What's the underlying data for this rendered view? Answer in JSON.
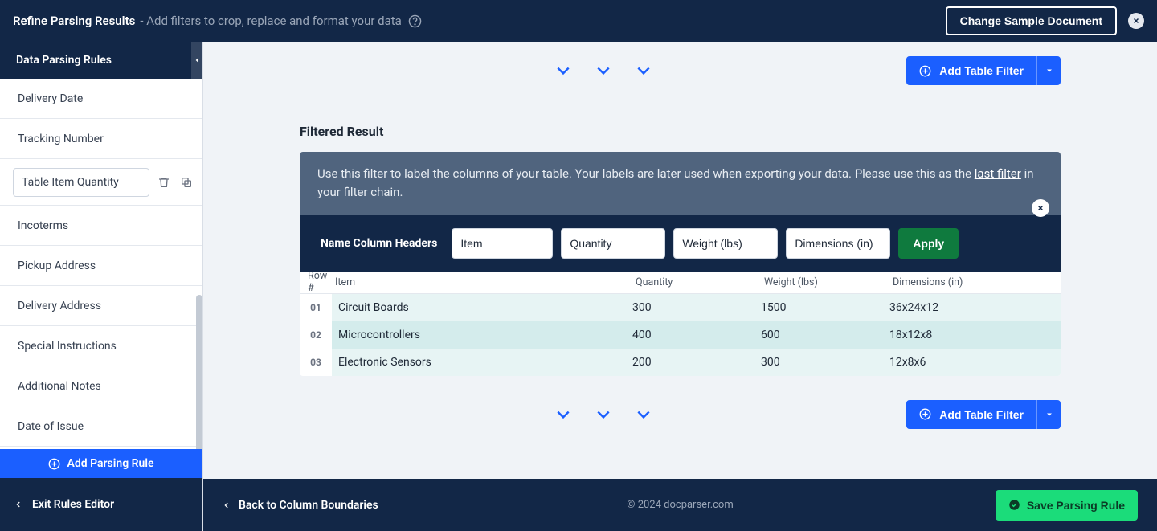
{
  "topbar": {
    "title": "Refine Parsing Results",
    "subtitle": "- Add filters to crop, replace and format your data",
    "change_button": "Change Sample Document"
  },
  "sidebar": {
    "header": "Data Parsing Rules",
    "rules": [
      "Delivery Date",
      "Tracking Number"
    ],
    "active_rule": "Table Item Quantity",
    "rules_after": [
      "Incoterms",
      "Pickup Address",
      "Delivery Address",
      "Special Instructions",
      "Additional Notes",
      "Date of Issue"
    ],
    "add_rule": "Add Parsing Rule",
    "exit": "Exit Rules Editor"
  },
  "main": {
    "add_filter": "Add Table Filter",
    "section_title": "Filtered Result",
    "info_prefix": "Use this filter to label the columns of your table. Your labels are later used when exporting your data. Please use this as the ",
    "info_link": "last filter",
    "info_suffix": " in your filter chain.",
    "inputs_label": "Name Column Headers",
    "headers": {
      "h1": "Item",
      "h2": "Quantity",
      "h3": "Weight (lbs)",
      "h4": "Dimensions (in)"
    },
    "apply": "Apply",
    "table": {
      "head_rownum": "Row #",
      "head_item": "Item",
      "head_qty": "Quantity",
      "head_wt": "Weight (lbs)",
      "head_dim": "Dimensions (in)",
      "rows": [
        {
          "n": "01",
          "item": "Circuit Boards",
          "qty": "300",
          "wt": "1500",
          "dim": "36x24x12"
        },
        {
          "n": "02",
          "item": "Microcontrollers",
          "qty": "400",
          "wt": "600",
          "dim": "18x12x8"
        },
        {
          "n": "03",
          "item": "Electronic Sensors",
          "qty": "200",
          "wt": "300",
          "dim": "12x8x6"
        }
      ]
    }
  },
  "footer": {
    "back": "Back to Column Boundaries",
    "copyright": "© 2024 docparser.com",
    "save": "Save Parsing Rule"
  }
}
